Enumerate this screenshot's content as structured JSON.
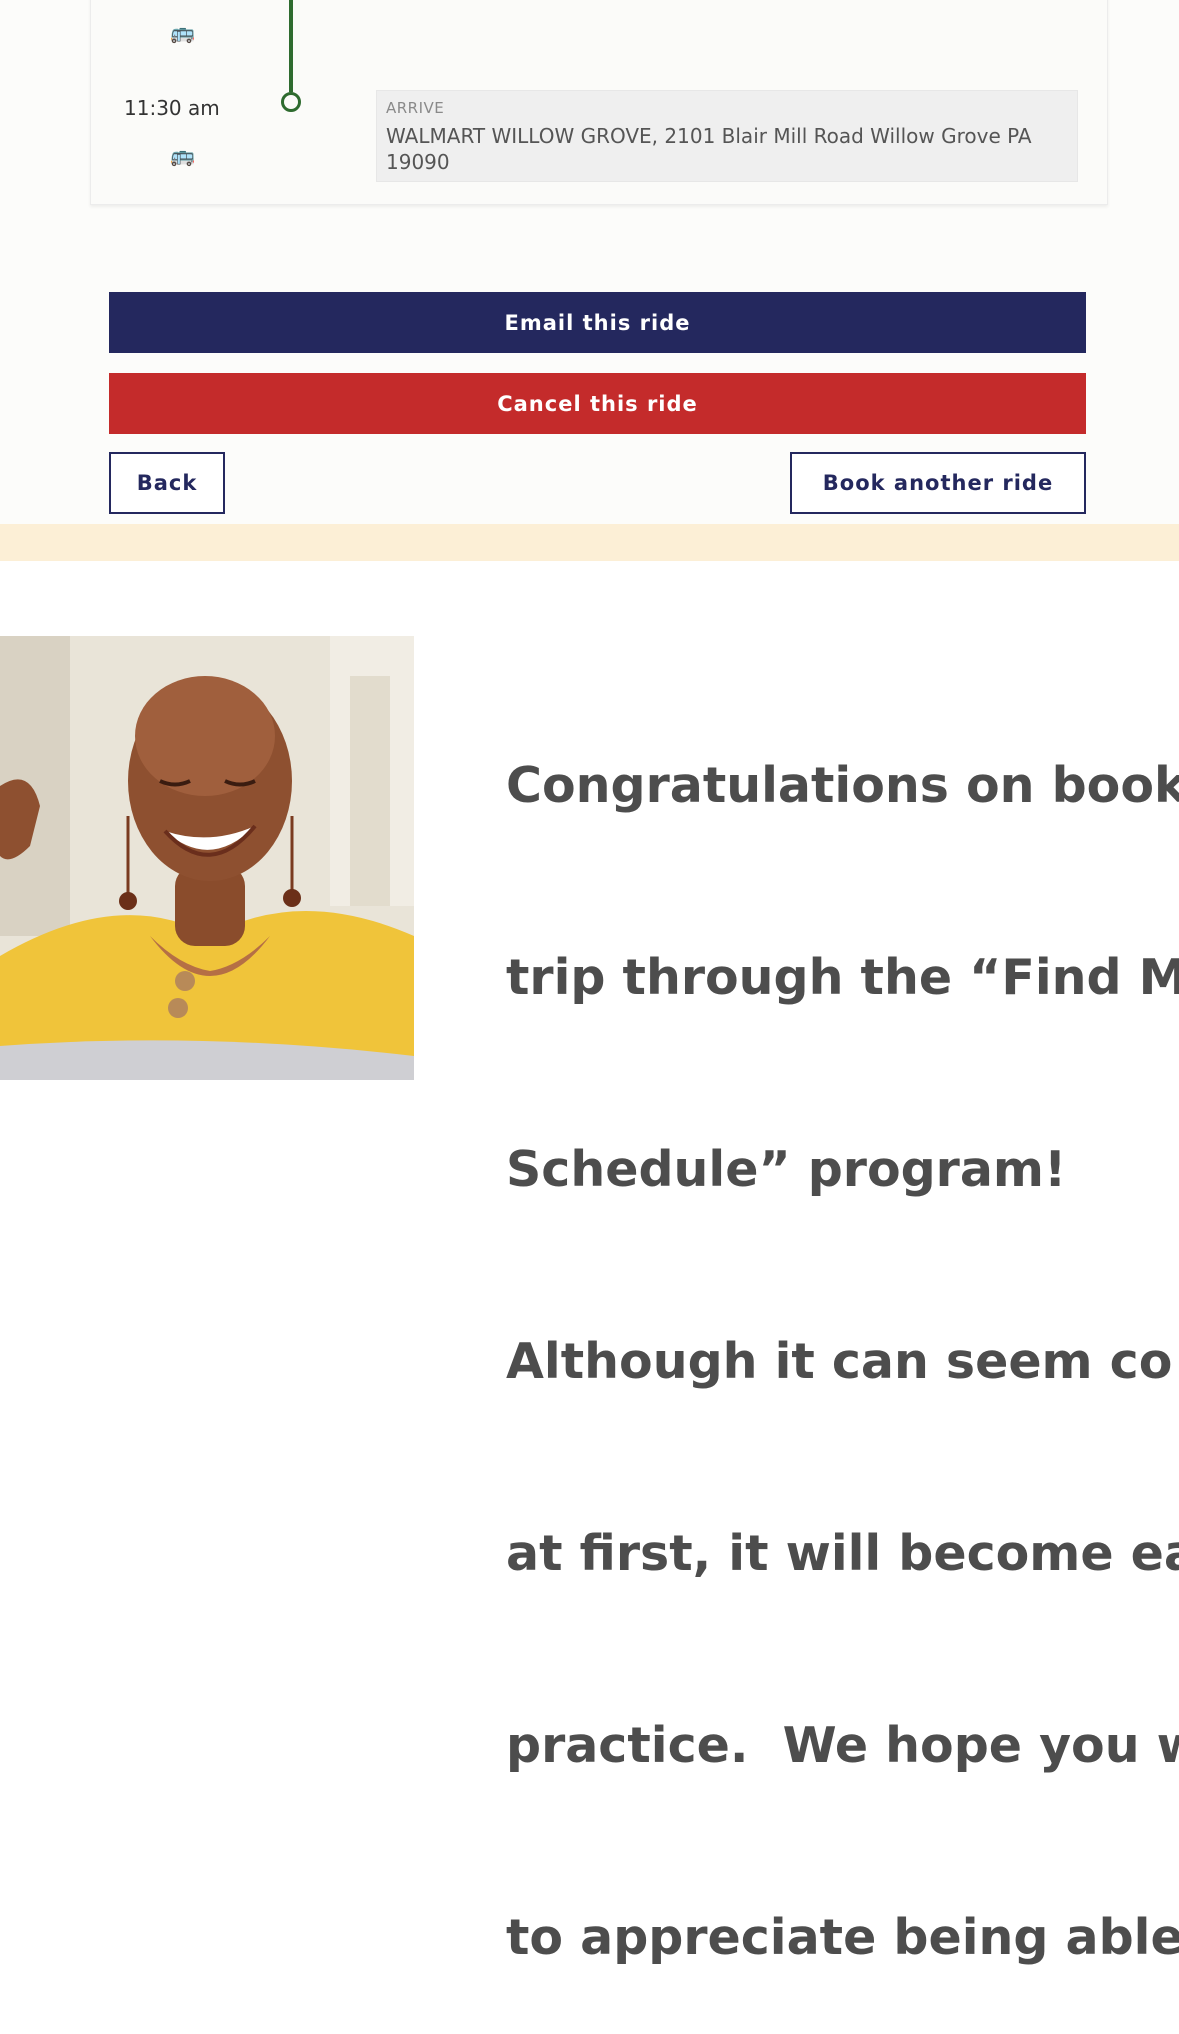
{
  "trip": {
    "arrive_time": "11:30 am",
    "arrive_label": "ARRIVE",
    "arrive_address": "WALMART WILLOW GROVE, 2101 Blair Mill Road Willow Grove PA 19090"
  },
  "actions": {
    "email_label": "Email this ride",
    "cancel_label": "Cancel this ride",
    "back_label": "Back",
    "book_another_label": "Book another ride"
  },
  "message": {
    "lines": [
      "Congratulations on book",
      "trip through the “Find My",
      "Schedule” program!",
      "Although it can seem co",
      "at first, it will become ea",
      "practice.  We hope you w",
      "to appreciate being able"
    ]
  },
  "colors": {
    "primary_navy": "#24285e",
    "cancel_red": "#c42b2b",
    "route_green": "#2e6b2f",
    "band_cream": "#fcefd6"
  },
  "icons": [
    "bus-icon",
    "route-stop-icon"
  ]
}
